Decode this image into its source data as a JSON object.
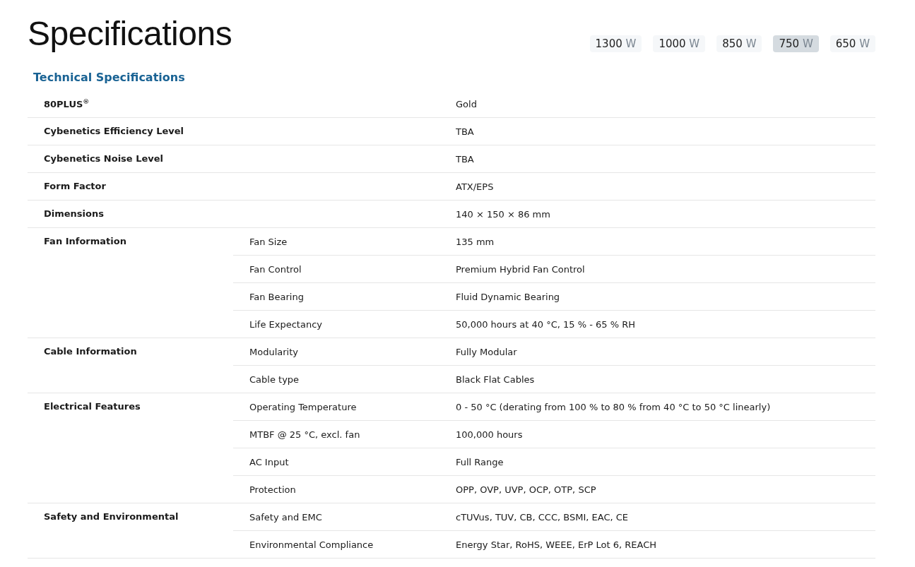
{
  "title": "Specifications",
  "wattage_tabs": [
    {
      "number": "1300",
      "unit": "W",
      "selected": false
    },
    {
      "number": "1000",
      "unit": "W",
      "selected": false
    },
    {
      "number": "850",
      "unit": "W",
      "selected": false
    },
    {
      "number": "750",
      "unit": "W",
      "selected": true
    },
    {
      "number": "650",
      "unit": "W",
      "selected": false
    }
  ],
  "section_title": "Technical Specifications",
  "groups": [
    {
      "label": "80PLUS$^{®}$",
      "items": [
        {
          "value": "Gold"
        }
      ]
    },
    {
      "label": "Cybenetics Efficiency Level",
      "items": [
        {
          "value": "TBA"
        }
      ]
    },
    {
      "label": "Cybenetics Noise Level",
      "items": [
        {
          "value": "TBA"
        }
      ]
    },
    {
      "label": "Form Factor",
      "items": [
        {
          "value": "ATX/EPS"
        }
      ]
    },
    {
      "label": "Dimensions",
      "items": [
        {
          "value": "140 × 150 × 86 mm"
        }
      ]
    },
    {
      "label": "Fan Information",
      "items": [
        {
          "name": "Fan Size",
          "value": "135 mm"
        },
        {
          "name": "Fan Control",
          "value": "Premium Hybrid Fan Control"
        },
        {
          "name": "Fan Bearing",
          "value": "Fluid Dynamic Bearing"
        },
        {
          "name": "Life Expectancy",
          "value": "50,000 hours at 40 °C, 15 % - 65 % RH"
        }
      ]
    },
    {
      "label": "Cable Information",
      "items": [
        {
          "name": "Modularity",
          "value": "Fully Modular"
        },
        {
          "name": "Cable type",
          "value": "Black Flat Cables"
        }
      ]
    },
    {
      "label": "Electrical Features",
      "items": [
        {
          "name": "Operating Temperature",
          "value": "0 - 50 °C (derating from 100 % to 80 % from 40 °C to 50 °C linearly)"
        },
        {
          "name": "MTBF @ 25 °C, excl. fan",
          "value": "100,000 hours"
        },
        {
          "name": "AC Input",
          "value": "Full Range"
        },
        {
          "name": "Protection",
          "value": "OPP, OVP, UVP, OCP, OTP, SCP"
        }
      ]
    },
    {
      "label": "Safety and Environmental",
      "items": [
        {
          "name": "Safety and EMC",
          "value": "cTUVus, TUV, CB, CCC, BSMI, EAC, CE"
        },
        {
          "name": "Environmental Compliance",
          "value": "Energy Star, RoHS, WEEE, ErP Lot 6, REACH"
        }
      ]
    }
  ]
}
